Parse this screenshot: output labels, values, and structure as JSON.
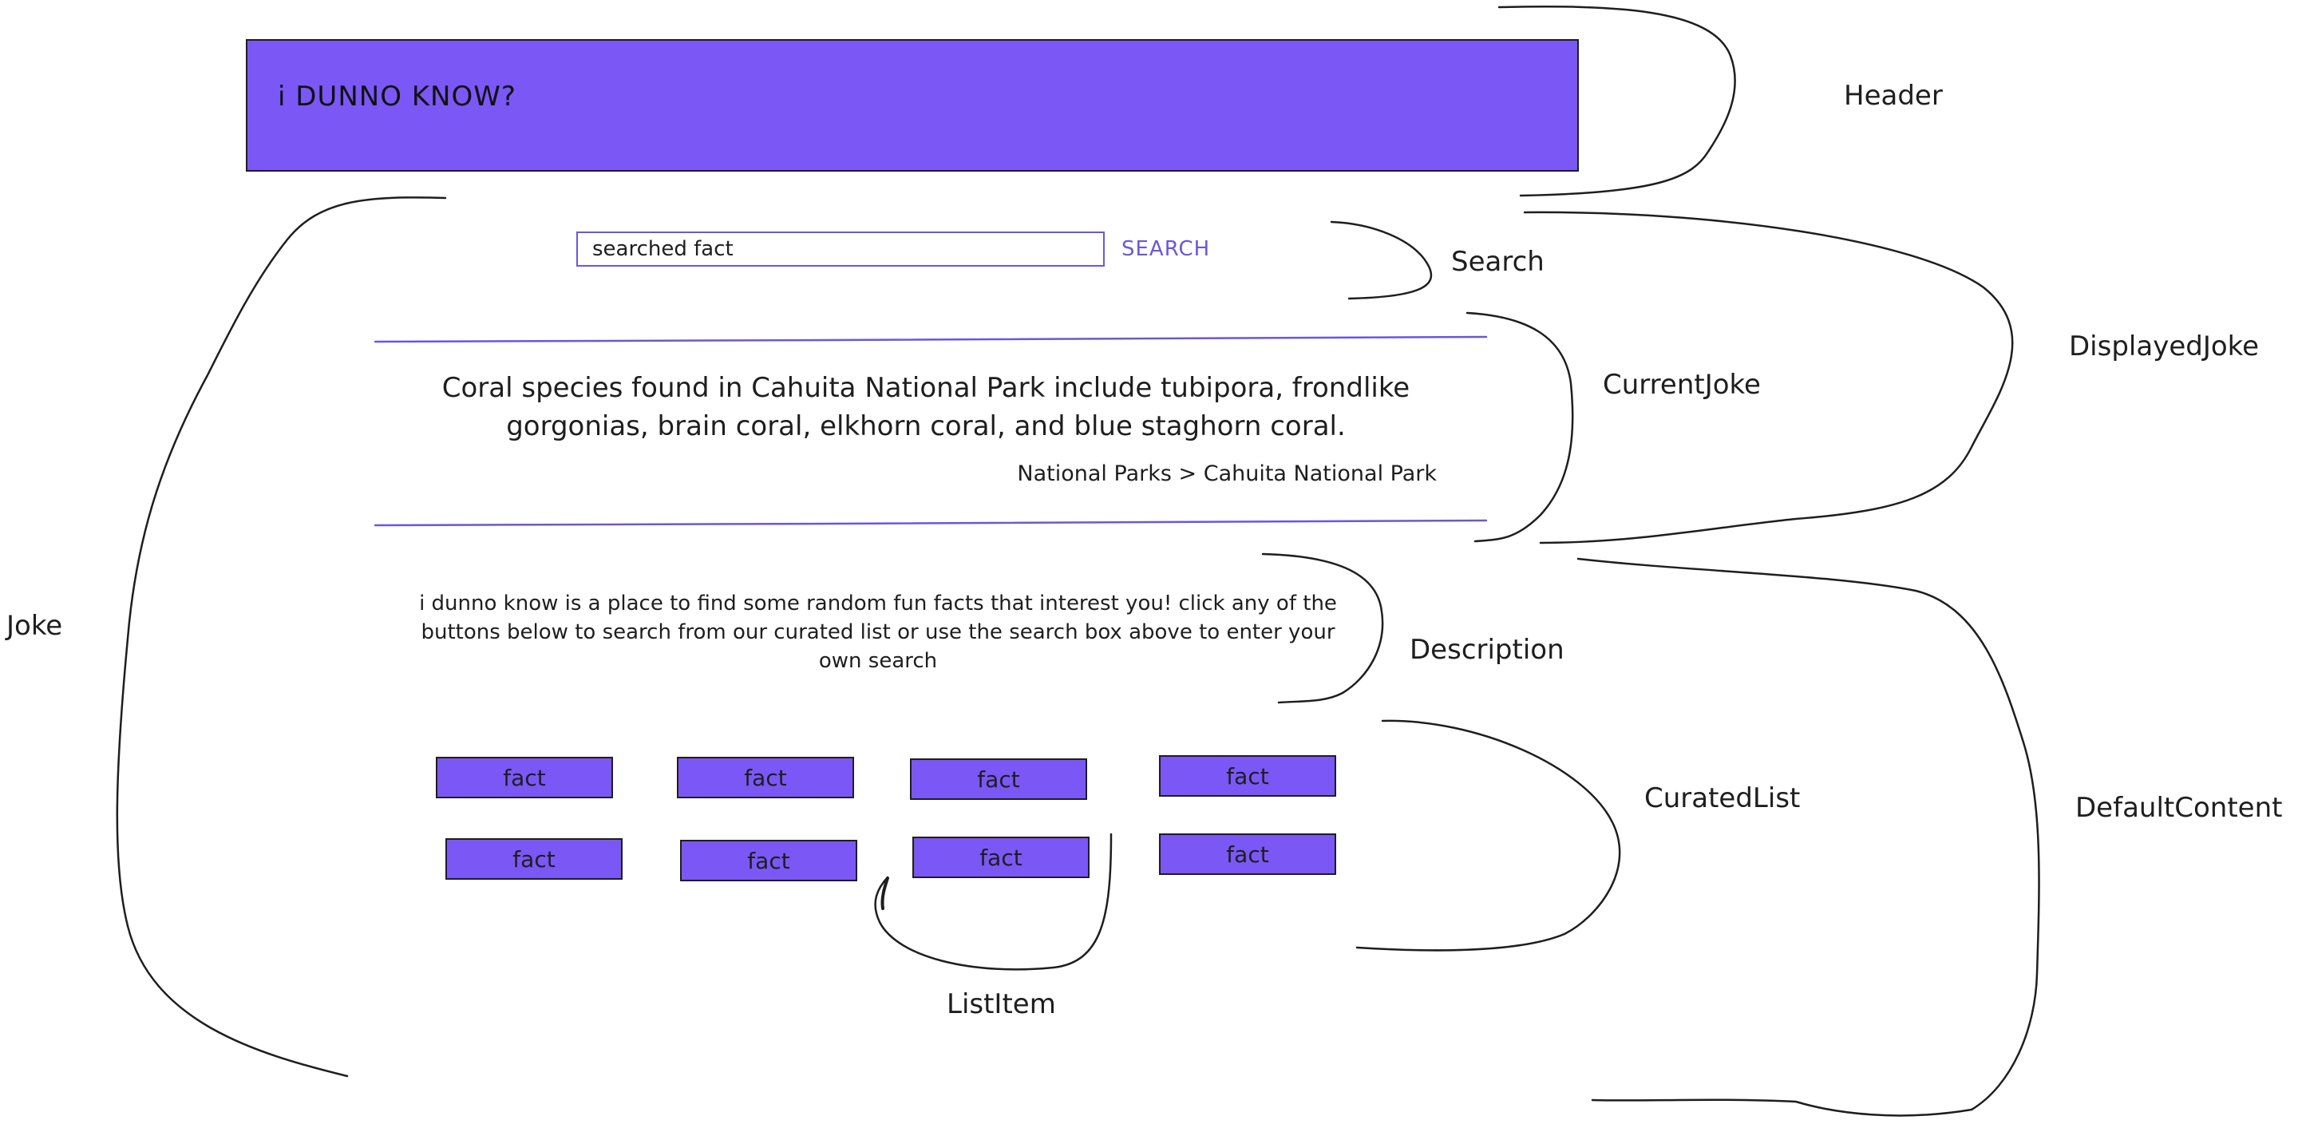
{
  "header": {
    "title": "i DUNNO KNOW?"
  },
  "search": {
    "value": "searched fact",
    "button_label": "SEARCH"
  },
  "current_joke": {
    "text": "Coral species found in Cahuita National Park include tubipora, frondlike gorgonias, brain coral, elkhorn coral, and blue staghorn coral.",
    "breadcrumb": "National Parks > Cahuita National Park"
  },
  "description": {
    "text": "i dunno know is a place to find some random fun facts that interest you! click any of the buttons below to search from our curated list or use the search box above to enter your own search"
  },
  "curated_list": {
    "items": [
      {
        "label": "fact"
      },
      {
        "label": "fact"
      },
      {
        "label": "fact"
      },
      {
        "label": "fact"
      },
      {
        "label": "fact"
      },
      {
        "label": "fact"
      },
      {
        "label": "fact"
      },
      {
        "label": "fact"
      }
    ]
  },
  "annotations": {
    "header": "Header",
    "search": "Search",
    "displayed_joke": "DisplayedJoke",
    "current_joke": "CurrentJoke",
    "joke": "Joke",
    "description": "Description",
    "curated_list": "CuratedList",
    "default_content": "DefaultContent",
    "list_item": "ListItem"
  },
  "colors": {
    "accent": "#7b57f5",
    "accent_text": "#6a58d8",
    "ink": "#1e1e1e",
    "background": "#ffffff"
  }
}
